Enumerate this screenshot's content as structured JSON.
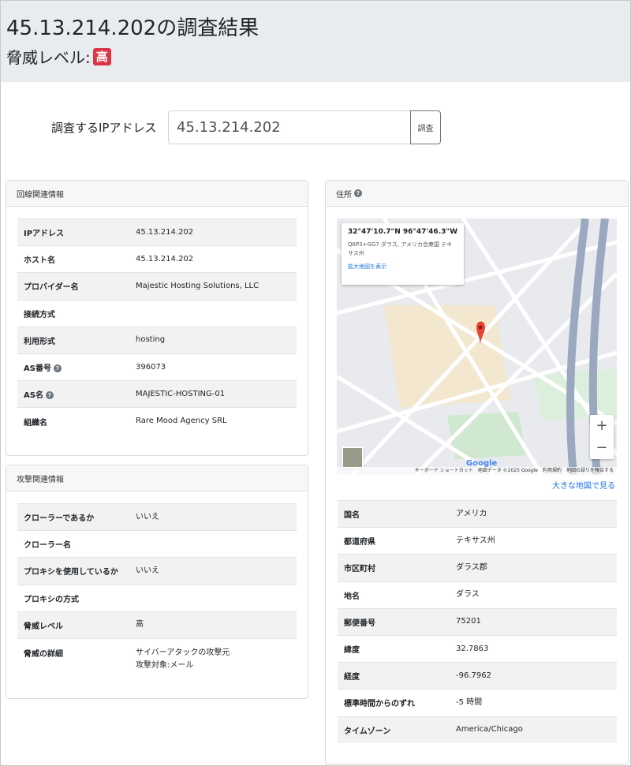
{
  "header": {
    "title": "45.13.214.202の調査結果",
    "threat_label": "脅威レベル:",
    "threat_value": "高"
  },
  "search": {
    "label": "調査するIPアドレス",
    "value": "45.13.214.202",
    "button": "調査"
  },
  "line_info": {
    "title": "回線関連情報",
    "rows": [
      {
        "key": "IPアドレス",
        "value": "45.13.214.202"
      },
      {
        "key": "ホスト名",
        "value": "45.13.214.202"
      },
      {
        "key": "プロバイダー名",
        "value": "Majestic Hosting Solutions, LLC"
      },
      {
        "key": "接続方式",
        "value": ""
      },
      {
        "key": "利用形式",
        "value": "hosting"
      },
      {
        "key": "AS番号",
        "value": "396073"
      },
      {
        "key": "AS名",
        "value": "MAJESTIC-HOSTING-01"
      },
      {
        "key": "組織名",
        "value": "Rare Mood Agency SRL"
      }
    ]
  },
  "attack_info": {
    "title": "攻撃関連情報",
    "rows": [
      {
        "key": "クローラーであるか",
        "value": "いいえ"
      },
      {
        "key": "クローラー名",
        "value": ""
      },
      {
        "key": "プロキシを使用しているか",
        "value": "いいえ"
      },
      {
        "key": "プロキシの方式",
        "value": ""
      },
      {
        "key": "脅威レベル",
        "value": "高"
      },
      {
        "key": "脅威の詳細",
        "value": "サイバーアタックの攻撃元",
        "value2": "攻撃対象:メール"
      }
    ]
  },
  "address_info": {
    "title": "住所",
    "map": {
      "coord": "32°47'10.7\"N 96°47'46.3\"W",
      "addr": "Q6P3+GG7 ダラス, アメリカ合衆国 テキサス州",
      "link": "拡大地図を表示",
      "footer": "キーボード ショートカット　地図データ ©2025 Google　利用規約　地図の誤りを報告する",
      "zoom_in": "+",
      "zoom_out": "−",
      "logo": "Google"
    },
    "bigger_map": "大きな地図で見る",
    "rows": [
      {
        "key": "国名",
        "value": "アメリカ"
      },
      {
        "key": "都道府県",
        "value": "テキサス州"
      },
      {
        "key": "市区町村",
        "value": "ダラス郡"
      },
      {
        "key": "地名",
        "value": "ダラス"
      },
      {
        "key": "郵便番号",
        "value": "75201"
      },
      {
        "key": "緯度",
        "value": "32.7863"
      },
      {
        "key": "経度",
        "value": "-96.7962"
      },
      {
        "key": "標準時間からのずれ",
        "value": "-5 時間"
      },
      {
        "key": "タイムゾーン",
        "value": "America/Chicago"
      }
    ]
  }
}
